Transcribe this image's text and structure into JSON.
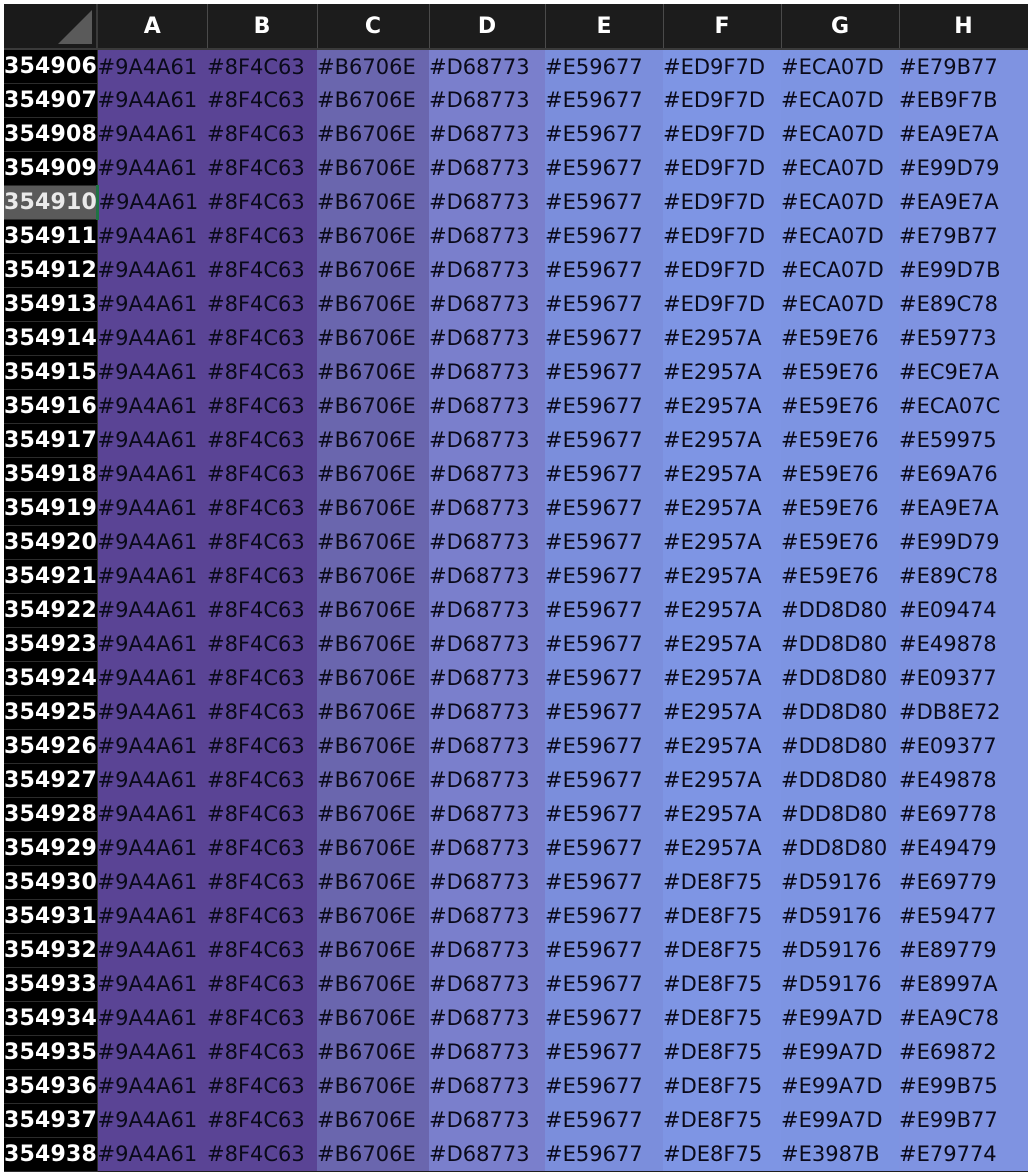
{
  "columns": [
    "A",
    "B",
    "C",
    "D",
    "E",
    "F",
    "G",
    "H"
  ],
  "column_colors": [
    "#5a4495",
    "#5a4495",
    "#6a66ae",
    "#7a7fcc",
    "#7b8edc",
    "#7e95e4",
    "#7d94e2",
    "#7f93e1"
  ],
  "active_row": "354910",
  "rows": [
    {
      "num": "354906",
      "cells": [
        "#9A4A61",
        "#8F4C63",
        "#B6706E",
        "#D68773",
        "#E59677",
        "#ED9F7D",
        "#ECA07D",
        "#E79B77"
      ]
    },
    {
      "num": "354907",
      "cells": [
        "#9A4A61",
        "#8F4C63",
        "#B6706E",
        "#D68773",
        "#E59677",
        "#ED9F7D",
        "#ECA07D",
        "#EB9F7B"
      ]
    },
    {
      "num": "354908",
      "cells": [
        "#9A4A61",
        "#8F4C63",
        "#B6706E",
        "#D68773",
        "#E59677",
        "#ED9F7D",
        "#ECA07D",
        "#EA9E7A"
      ]
    },
    {
      "num": "354909",
      "cells": [
        "#9A4A61",
        "#8F4C63",
        "#B6706E",
        "#D68773",
        "#E59677",
        "#ED9F7D",
        "#ECA07D",
        "#E99D79"
      ]
    },
    {
      "num": "354910",
      "cells": [
        "#9A4A61",
        "#8F4C63",
        "#B6706E",
        "#D68773",
        "#E59677",
        "#ED9F7D",
        "#ECA07D",
        "#EA9E7A"
      ]
    },
    {
      "num": "354911",
      "cells": [
        "#9A4A61",
        "#8F4C63",
        "#B6706E",
        "#D68773",
        "#E59677",
        "#ED9F7D",
        "#ECA07D",
        "#E79B77"
      ]
    },
    {
      "num": "354912",
      "cells": [
        "#9A4A61",
        "#8F4C63",
        "#B6706E",
        "#D68773",
        "#E59677",
        "#ED9F7D",
        "#ECA07D",
        "#E99D7B"
      ]
    },
    {
      "num": "354913",
      "cells": [
        "#9A4A61",
        "#8F4C63",
        "#B6706E",
        "#D68773",
        "#E59677",
        "#ED9F7D",
        "#ECA07D",
        "#E89C78"
      ]
    },
    {
      "num": "354914",
      "cells": [
        "#9A4A61",
        "#8F4C63",
        "#B6706E",
        "#D68773",
        "#E59677",
        "#E2957A",
        "#E59E76",
        "#E59773"
      ]
    },
    {
      "num": "354915",
      "cells": [
        "#9A4A61",
        "#8F4C63",
        "#B6706E",
        "#D68773",
        "#E59677",
        "#E2957A",
        "#E59E76",
        "#EC9E7A"
      ]
    },
    {
      "num": "354916",
      "cells": [
        "#9A4A61",
        "#8F4C63",
        "#B6706E",
        "#D68773",
        "#E59677",
        "#E2957A",
        "#E59E76",
        "#ECA07C"
      ]
    },
    {
      "num": "354917",
      "cells": [
        "#9A4A61",
        "#8F4C63",
        "#B6706E",
        "#D68773",
        "#E59677",
        "#E2957A",
        "#E59E76",
        "#E59975"
      ]
    },
    {
      "num": "354918",
      "cells": [
        "#9A4A61",
        "#8F4C63",
        "#B6706E",
        "#D68773",
        "#E59677",
        "#E2957A",
        "#E59E76",
        "#E69A76"
      ]
    },
    {
      "num": "354919",
      "cells": [
        "#9A4A61",
        "#8F4C63",
        "#B6706E",
        "#D68773",
        "#E59677",
        "#E2957A",
        "#E59E76",
        "#EA9E7A"
      ]
    },
    {
      "num": "354920",
      "cells": [
        "#9A4A61",
        "#8F4C63",
        "#B6706E",
        "#D68773",
        "#E59677",
        "#E2957A",
        "#E59E76",
        "#E99D79"
      ]
    },
    {
      "num": "354921",
      "cells": [
        "#9A4A61",
        "#8F4C63",
        "#B6706E",
        "#D68773",
        "#E59677",
        "#E2957A",
        "#E59E76",
        "#E89C78"
      ]
    },
    {
      "num": "354922",
      "cells": [
        "#9A4A61",
        "#8F4C63",
        "#B6706E",
        "#D68773",
        "#E59677",
        "#E2957A",
        "#DD8D80",
        "#E09474"
      ]
    },
    {
      "num": "354923",
      "cells": [
        "#9A4A61",
        "#8F4C63",
        "#B6706E",
        "#D68773",
        "#E59677",
        "#E2957A",
        "#DD8D80",
        "#E49878"
      ]
    },
    {
      "num": "354924",
      "cells": [
        "#9A4A61",
        "#8F4C63",
        "#B6706E",
        "#D68773",
        "#E59677",
        "#E2957A",
        "#DD8D80",
        "#E09377"
      ]
    },
    {
      "num": "354925",
      "cells": [
        "#9A4A61",
        "#8F4C63",
        "#B6706E",
        "#D68773",
        "#E59677",
        "#E2957A",
        "#DD8D80",
        "#DB8E72"
      ]
    },
    {
      "num": "354926",
      "cells": [
        "#9A4A61",
        "#8F4C63",
        "#B6706E",
        "#D68773",
        "#E59677",
        "#E2957A",
        "#DD8D80",
        "#E09377"
      ]
    },
    {
      "num": "354927",
      "cells": [
        "#9A4A61",
        "#8F4C63",
        "#B6706E",
        "#D68773",
        "#E59677",
        "#E2957A",
        "#DD8D80",
        "#E49878"
      ]
    },
    {
      "num": "354928",
      "cells": [
        "#9A4A61",
        "#8F4C63",
        "#B6706E",
        "#D68773",
        "#E59677",
        "#E2957A",
        "#DD8D80",
        "#E69778"
      ]
    },
    {
      "num": "354929",
      "cells": [
        "#9A4A61",
        "#8F4C63",
        "#B6706E",
        "#D68773",
        "#E59677",
        "#E2957A",
        "#DD8D80",
        "#E49479"
      ]
    },
    {
      "num": "354930",
      "cells": [
        "#9A4A61",
        "#8F4C63",
        "#B6706E",
        "#D68773",
        "#E59677",
        "#DE8F75",
        "#D59176",
        "#E69779"
      ]
    },
    {
      "num": "354931",
      "cells": [
        "#9A4A61",
        "#8F4C63",
        "#B6706E",
        "#D68773",
        "#E59677",
        "#DE8F75",
        "#D59176",
        "#E59477"
      ]
    },
    {
      "num": "354932",
      "cells": [
        "#9A4A61",
        "#8F4C63",
        "#B6706E",
        "#D68773",
        "#E59677",
        "#DE8F75",
        "#D59176",
        "#E89779"
      ]
    },
    {
      "num": "354933",
      "cells": [
        "#9A4A61",
        "#8F4C63",
        "#B6706E",
        "#D68773",
        "#E59677",
        "#DE8F75",
        "#D59176",
        "#E8997A"
      ]
    },
    {
      "num": "354934",
      "cells": [
        "#9A4A61",
        "#8F4C63",
        "#B6706E",
        "#D68773",
        "#E59677",
        "#DE8F75",
        "#E99A7D",
        "#EA9C78"
      ]
    },
    {
      "num": "354935",
      "cells": [
        "#9A4A61",
        "#8F4C63",
        "#B6706E",
        "#D68773",
        "#E59677",
        "#DE8F75",
        "#E99A7D",
        "#E69872"
      ]
    },
    {
      "num": "354936",
      "cells": [
        "#9A4A61",
        "#8F4C63",
        "#B6706E",
        "#D68773",
        "#E59677",
        "#DE8F75",
        "#E99A7D",
        "#E99B75"
      ]
    },
    {
      "num": "354937",
      "cells": [
        "#9A4A61",
        "#8F4C63",
        "#B6706E",
        "#D68773",
        "#E59677",
        "#DE8F75",
        "#E99A7D",
        "#E99B77"
      ]
    },
    {
      "num": "354938",
      "cells": [
        "#9A4A61",
        "#8F4C63",
        "#B6706E",
        "#D68773",
        "#E59677",
        "#DE8F75",
        "#E3987B",
        "#E79774"
      ]
    }
  ]
}
